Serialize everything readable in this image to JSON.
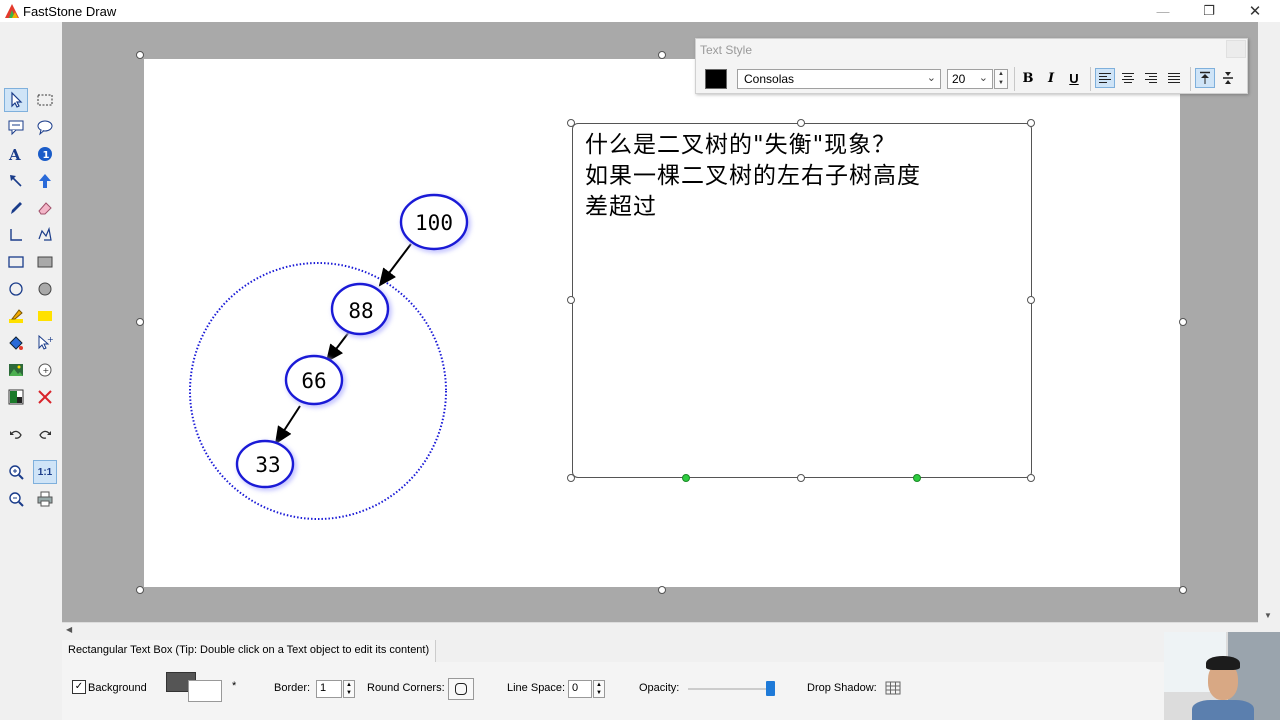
{
  "app": {
    "title": "FastStone Draw",
    "window_buttons": {
      "minimize": "—",
      "restore": "❐",
      "close": "✕"
    }
  },
  "toolbar": {
    "tools": [
      {
        "name": "select-tool-icon",
        "active": true
      },
      {
        "name": "rect-select-tool-icon",
        "active": false
      },
      {
        "name": "callout-rect-tool-icon",
        "active": false
      },
      {
        "name": "callout-round-tool-icon",
        "active": false
      },
      {
        "name": "text-tool-icon",
        "active": false
      },
      {
        "name": "info-badge-tool-icon",
        "active": false
      },
      {
        "name": "arrow-tool-icon",
        "active": false
      },
      {
        "name": "block-arrow-tool-icon",
        "active": false
      },
      {
        "name": "pen-tool-icon",
        "active": false
      },
      {
        "name": "eraser-tool-icon",
        "active": false
      },
      {
        "name": "line-tool-icon",
        "active": false
      },
      {
        "name": "polyline-tool-icon",
        "active": false
      },
      {
        "name": "rectangle-tool-icon",
        "active": false
      },
      {
        "name": "filled-rectangle-tool-icon",
        "active": false
      },
      {
        "name": "ellipse-tool-icon",
        "active": false
      },
      {
        "name": "filled-ellipse-tool-icon",
        "active": false
      },
      {
        "name": "highlighter-tool-icon",
        "active": false
      },
      {
        "name": "highlight-rect-tool-icon",
        "active": false
      },
      {
        "name": "fill-tool-icon",
        "active": false
      },
      {
        "name": "pointer-plus-tool-icon",
        "active": false
      },
      {
        "name": "image-tool-icon",
        "active": false
      },
      {
        "name": "step-marker-tool-icon",
        "active": false
      },
      {
        "name": "color-picker-tool-icon",
        "active": false
      },
      {
        "name": "delete-tool-icon",
        "active": false
      },
      {
        "name": "undo-icon",
        "active": false
      },
      {
        "name": "redo-icon",
        "active": false
      },
      {
        "name": "zoom-in-icon",
        "active": false
      },
      {
        "name": "actual-size-icon",
        "active": true,
        "label": "1:1"
      },
      {
        "name": "zoom-out-icon",
        "active": false
      },
      {
        "name": "print-icon",
        "active": false
      }
    ]
  },
  "text_style": {
    "title": "Text Style",
    "color": "#000000",
    "font": "Consolas",
    "size": "20",
    "bold": "B",
    "italic": "I",
    "underline": "U"
  },
  "diagram": {
    "nodes": [
      "100",
      "88",
      "66",
      "33"
    ],
    "node_color": "#1a1ad6"
  },
  "textbox": {
    "content": "什么是二叉树的\"失衡\"现象？\n如果一棵二叉树的左右子树高度\n差超过"
  },
  "status": {
    "hint": "Rectangular Text Box (Tip: Double click on a Text object to edit its content)",
    "background_label": "Background",
    "background_checked": "✓",
    "border_label": "Border:",
    "border_value": "1",
    "round_corners_label": "Round Corners:",
    "line_space_label": "Line Space:",
    "line_space_value": "0",
    "opacity_label": "Opacity:",
    "drop_shadow_label": "Drop Shadow:",
    "swap_label": "*",
    "fore_color": "#555555",
    "back_color": "#ffffff"
  }
}
